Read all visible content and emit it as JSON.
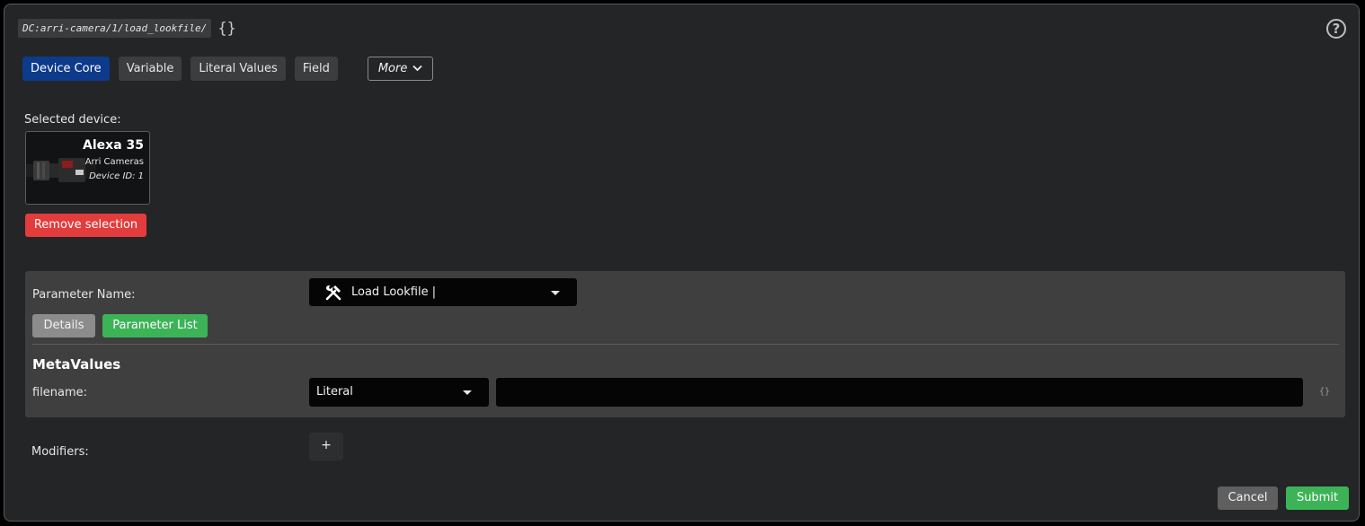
{
  "header": {
    "path": "DC:arri-camera/1/load_lookfile/",
    "braces": "{}",
    "help_icon": "question-circle-icon"
  },
  "tabs": [
    {
      "label": "Device Core",
      "active": true
    },
    {
      "label": "Variable",
      "active": false
    },
    {
      "label": "Literal Values",
      "active": false
    },
    {
      "label": "Field",
      "active": false
    }
  ],
  "more": {
    "label": "More",
    "icon": "chevron-down-icon"
  },
  "device": {
    "selected_label": "Selected device:",
    "name": "Alexa 35",
    "manufacturer": "Arri Cameras",
    "device_id": "Device ID: 1",
    "image": "camera-image",
    "remove_label": "Remove selection"
  },
  "parameter": {
    "name_label": "Parameter Name:",
    "selected": "Load Lookfile |",
    "icon": "tools-icon",
    "details_label": "Details",
    "parameter_list_label": "Parameter List"
  },
  "metavalues": {
    "title": "MetaValues",
    "fields": [
      {
        "label": "filename:",
        "mode": "Literal",
        "value": "",
        "braces": "{}"
      }
    ]
  },
  "modifiers": {
    "label": "Modifiers:",
    "add_label": "+"
  },
  "footer": {
    "cancel_label": "Cancel",
    "submit_label": "Submit"
  },
  "colors": {
    "panel_bg": "#242527",
    "accent_blue": "#0d3a8a",
    "danger": "#e23c3c",
    "success": "#3db357",
    "param_bg": "#3f3f3f"
  }
}
